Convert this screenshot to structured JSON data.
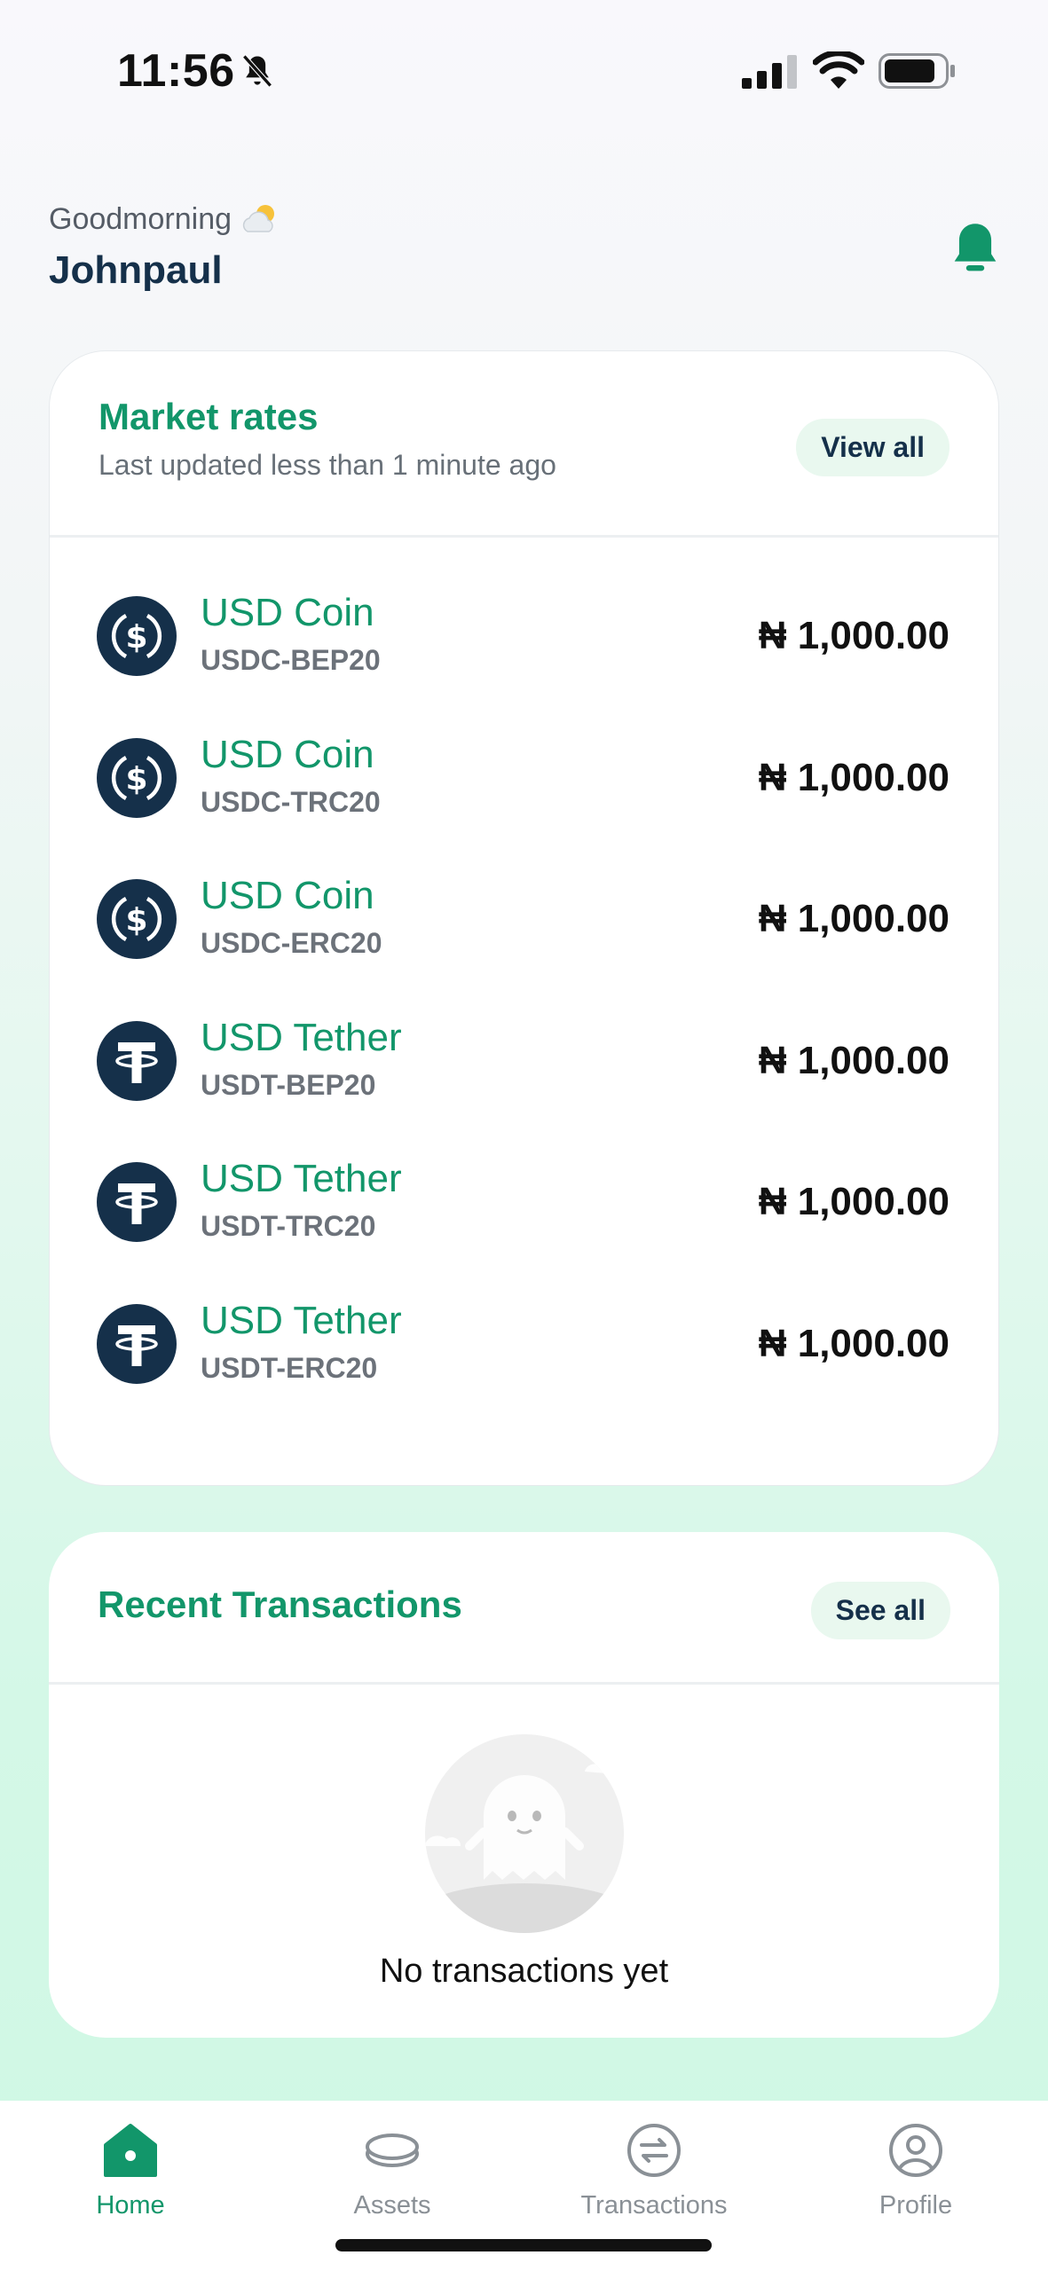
{
  "status_bar": {
    "time": "11:56"
  },
  "header": {
    "greeting": "Goodmorning",
    "username": "Johnpaul"
  },
  "market_rates": {
    "title": "Market rates",
    "subtitle": "Last updated less than 1 minute ago",
    "view_all_label": "View all",
    "items": [
      {
        "name": "USD Coin",
        "code": "USDC-BEP20",
        "price": "₦ 1,000.00",
        "icon": "usdc-icon"
      },
      {
        "name": "USD Coin",
        "code": "USDC-TRC20",
        "price": "₦ 1,000.00",
        "icon": "usdc-icon"
      },
      {
        "name": "USD Coin",
        "code": "USDC-ERC20",
        "price": "₦ 1,000.00",
        "icon": "usdc-icon"
      },
      {
        "name": "USD Tether",
        "code": "USDT-BEP20",
        "price": "₦ 1,000.00",
        "icon": "usdt-icon"
      },
      {
        "name": "USD Tether",
        "code": "USDT-TRC20",
        "price": "₦ 1,000.00",
        "icon": "usdt-icon"
      },
      {
        "name": "USD Tether",
        "code": "USDT-ERC20",
        "price": "₦ 1,000.00",
        "icon": "usdt-icon"
      }
    ]
  },
  "recent_transactions": {
    "title": "Recent Transactions",
    "see_all_label": "See all",
    "empty_text": "No transactions yet"
  },
  "nav": {
    "items": [
      {
        "label": "Home",
        "icon": "home-icon",
        "active": true
      },
      {
        "label": "Assets",
        "icon": "coins-icon",
        "active": false
      },
      {
        "label": "Transactions",
        "icon": "exchange-icon",
        "active": false
      },
      {
        "label": "Profile",
        "icon": "profile-icon",
        "active": false
      }
    ]
  },
  "colors": {
    "accent": "#12966a",
    "navy": "#15304a",
    "pill_bg": "#e9f8ef",
    "coin_icon_bg": "#15304a"
  }
}
